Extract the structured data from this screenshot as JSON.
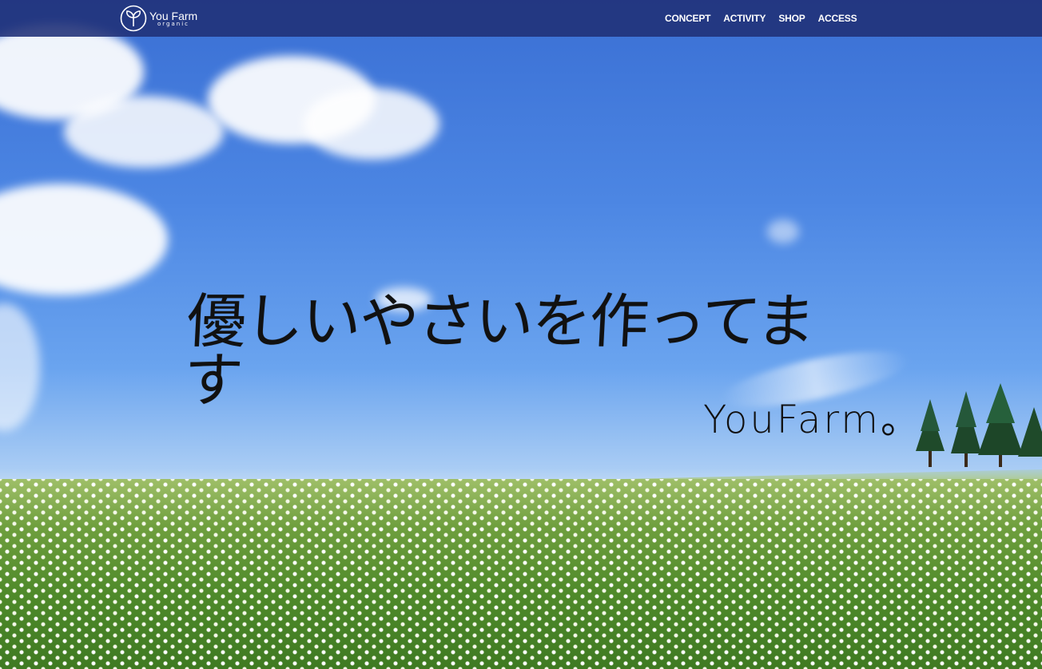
{
  "header": {
    "logo": {
      "name": "You Farm",
      "sub": "organic"
    },
    "nav": [
      {
        "label": "CONCEPT"
      },
      {
        "label": "ACTIVITY"
      },
      {
        "label": "SHOP"
      },
      {
        "label": "ACCESS"
      }
    ]
  },
  "hero": {
    "tagline": "優しいやさいを作ってます",
    "signature": "YouFarm。"
  },
  "colors": {
    "header_bg": "#203076",
    "sky": "#4c86e3",
    "field": "#4f8a2a"
  }
}
